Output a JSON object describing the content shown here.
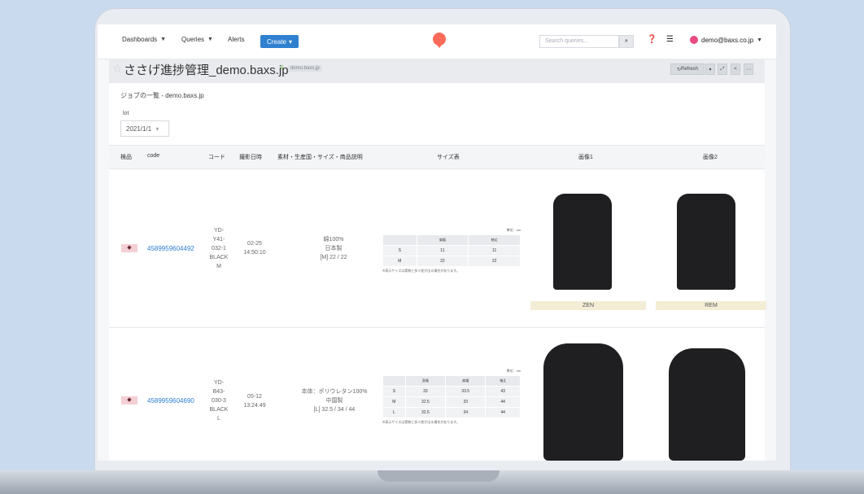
{
  "header": {
    "dashboards": "Dashboards",
    "queries": "Queries",
    "alerts": "Alerts",
    "create": "Create",
    "search_placeholder": "Search queries...",
    "user": "demo@baxs.co.jp"
  },
  "page": {
    "title": "ささげ進捗管理_demo.baxs.jp",
    "tag": "demo.baxs.jp",
    "refresh": "Refresh",
    "subtitle": "ジョブの一覧 - demo.baxs.jp",
    "lot_label": "lot",
    "lot_value": "2021/1/1"
  },
  "table": {
    "headers": [
      "検品",
      "code",
      "コード",
      "撮影日時",
      "素材・生産国・サイズ・商品説明",
      "サイズ表",
      "画像1",
      "画像2"
    ],
    "rows": [
      {
        "code": "4589959604492",
        "kode": [
          "YD-",
          "Y41-",
          "032-1",
          "BLACK",
          "M"
        ],
        "date": [
          "02-25",
          "14:50:10"
        ],
        "material": [
          "綿100%",
          "日本製",
          "[M] 22 / 22"
        ],
        "size": {
          "unit": "単位：cm",
          "headers": [
            "",
            "肩幅",
            "袖丈"
          ],
          "rows": [
            [
              "S",
              "11",
              "11"
            ],
            [
              "M",
              "22",
              "22"
            ]
          ],
          "note": "※表示サイズは実物と多少差が出る場合があります。"
        },
        "label1": "ZEN",
        "label2": "REM"
      },
      {
        "code": "4589959604690",
        "kode": [
          "YD-",
          "B43-",
          "030-3",
          "BLACK",
          "L"
        ],
        "date": [
          "05-12",
          "13:24:49"
        ],
        "material": [
          "本体：ポリウレタン100%",
          "中国製",
          "[L] 32.5 / 34 / 44"
        ],
        "size": {
          "unit": "単位：cm",
          "headers": [
            "",
            "身幅",
            "肩幅",
            "袖丈"
          ],
          "rows": [
            [
              "S",
              "33",
              "33.5",
              "43"
            ],
            [
              "M",
              "32.5",
              "33",
              "44"
            ],
            [
              "L",
              "32.5",
              "34",
              "44"
            ]
          ],
          "note": "※表示サイズは実物と多少差が出る場合があります。"
        }
      }
    ]
  }
}
